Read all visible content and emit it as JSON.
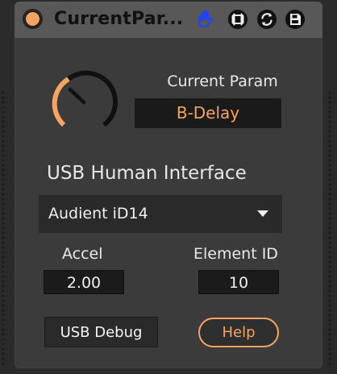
{
  "header": {
    "title": "CurrentPar..."
  },
  "icons": {
    "power": "power-icon",
    "hand": "hand-icon",
    "map": "map-icon",
    "sync": "sync-icon",
    "save": "save-icon",
    "dropdown": "chevron-down-icon"
  },
  "colors": {
    "accent": "#f7a45f",
    "panel": "#3b3b3b",
    "title_bar": "#585858",
    "field": "#1a1a1a",
    "hand_icon": "#1e46ff"
  },
  "current_param": {
    "label": "Current Param",
    "value": "B-Delay"
  },
  "usb": {
    "heading": "USB Human Interface",
    "selected_device": "Audient iD14"
  },
  "controls": {
    "accel_label": "Accel",
    "accel_value": "2.00",
    "element_label": "Element ID",
    "element_value": "10",
    "debug_label": "USB Debug",
    "help_label": "Help"
  }
}
